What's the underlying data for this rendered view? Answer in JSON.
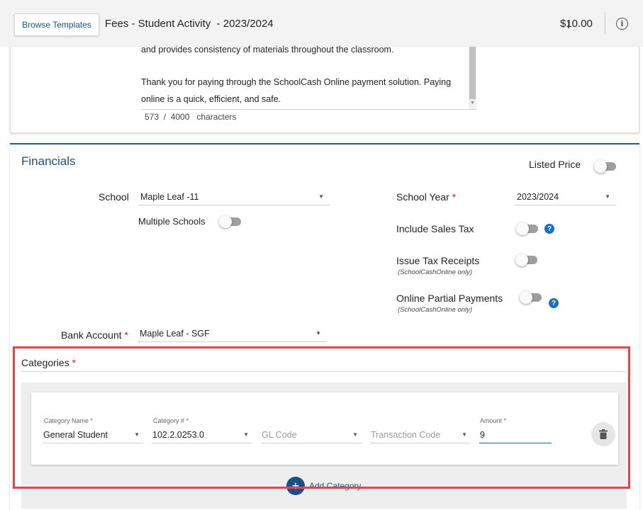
{
  "header": {
    "browse_templates": "Browse Templates",
    "title": "Fees - Student Activity  - 2023/2024",
    "total": "$10.00",
    "info_icon": "info-icon"
  },
  "description": {
    "line1": "and provides consistency of materials throughout the classroom.",
    "line2": "Thank you for paying through the SchoolCash Online payment solution.  Paying",
    "line3": "online is a quick, efficient, and safe.",
    "char_count": "573  /  4000   characters"
  },
  "financials": {
    "title": "Financials",
    "listed_price_label": "Listed Price",
    "school_label": "School",
    "school_value": "Maple Leaf -11",
    "multiple_schools_label": "Multiple Schools",
    "school_year_label": "School Year",
    "school_year_value": "2023/2024",
    "include_sales_tax_label": "Include Sales Tax",
    "issue_tax_receipts_label": "Issue Tax Receipts",
    "issue_tax_receipts_sub": "(SchoolCashOnline only)",
    "online_partial_label": "Online Partial Payments",
    "online_partial_sub": "(SchoolCashOnline only)",
    "bank_account_label": "Bank Account",
    "bank_account_value": "Maple Leaf - SGF",
    "required_mark": "*"
  },
  "categories": {
    "title": "Categories",
    "required_mark": "*",
    "row": {
      "category_name_label": "Category Name *",
      "category_name_value": "General Student",
      "category_num_label": "Category # *",
      "category_num_value": "102.2.0253.0",
      "gl_code_placeholder": "GL Code",
      "transaction_code_placeholder": "Transaction Code",
      "amount_label": "Amount *",
      "amount_value": "9"
    },
    "add_category": "Add Category"
  },
  "colors": {
    "accent": "#1a4f8a",
    "required": "#c62828",
    "highlight": "#e04848"
  }
}
